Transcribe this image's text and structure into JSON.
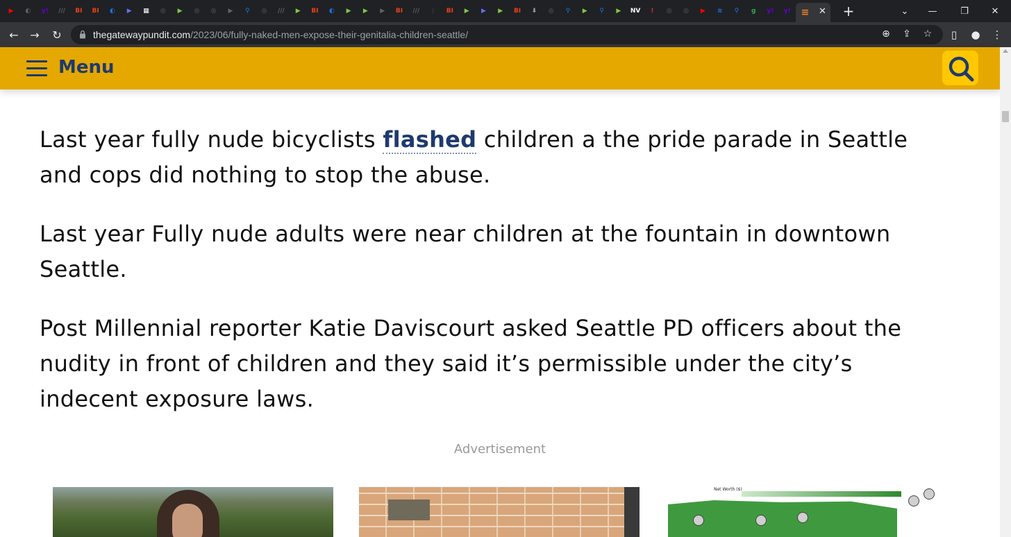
{
  "browser": {
    "tab_favicons": [
      {
        "icon": "youtube-icon",
        "color": "#ff0000",
        "glyph": "▶"
      },
      {
        "icon": "shield-icon",
        "color": "#5f6368",
        "glyph": "◐"
      },
      {
        "icon": "yahoo-icon",
        "color": "#6001d2",
        "glyph": "y!"
      },
      {
        "icon": "stripes-icon",
        "color": "#5f6368",
        "glyph": "///"
      },
      {
        "icon": "bi-icon",
        "color": "#e8401c",
        "glyph": "BI"
      },
      {
        "icon": "bi-icon",
        "color": "#e8401c",
        "glyph": "BI"
      },
      {
        "icon": "shield-icon",
        "color": "#1a73e8",
        "glyph": "◐"
      },
      {
        "icon": "flag-icon",
        "color": "#5f6fff",
        "glyph": "▶"
      },
      {
        "icon": "image-icon",
        "color": "#ffffff",
        "glyph": "▦"
      },
      {
        "icon": "globe-icon",
        "color": "#5f6368",
        "glyph": "◎"
      },
      {
        "icon": "rumble-icon",
        "color": "#85c742",
        "glyph": "▶"
      },
      {
        "icon": "globe-icon",
        "color": "#5f6368",
        "glyph": "◎"
      },
      {
        "icon": "globe-icon",
        "color": "#5f6368",
        "glyph": "◎"
      },
      {
        "icon": "flag-icon",
        "color": "#5f6368",
        "glyph": "▶"
      },
      {
        "icon": "search-icon",
        "color": "#1a73e8",
        "glyph": "⚲"
      },
      {
        "icon": "globe-icon",
        "color": "#5f6368",
        "glyph": "◎"
      },
      {
        "icon": "stripes-icon",
        "color": "#5f6368",
        "glyph": "///"
      },
      {
        "icon": "rumble-icon",
        "color": "#85c742",
        "glyph": "▶"
      },
      {
        "icon": "bi-icon",
        "color": "#e8401c",
        "glyph": "BI"
      },
      {
        "icon": "shield-icon",
        "color": "#1a73e8",
        "glyph": "◐"
      },
      {
        "icon": "rumble-icon",
        "color": "#85c742",
        "glyph": "▶"
      },
      {
        "icon": "rumble-icon",
        "color": "#85c742",
        "glyph": "▶"
      },
      {
        "icon": "flag-icon",
        "color": "#5f6368",
        "glyph": "▶"
      },
      {
        "icon": "bi-icon",
        "color": "#e8401c",
        "glyph": "BI"
      },
      {
        "icon": "stripes-icon",
        "color": "#5f6368",
        "glyph": "///"
      },
      {
        "icon": "dark-icon",
        "color": "#2b2b2b",
        "glyph": "▮"
      },
      {
        "icon": "bi-icon",
        "color": "#e8401c",
        "glyph": "BI"
      },
      {
        "icon": "rumble-icon",
        "color": "#85c742",
        "glyph": "▶"
      },
      {
        "icon": "flag-icon",
        "color": "#5f6fff",
        "glyph": "▶"
      },
      {
        "icon": "rumble-icon",
        "color": "#85c742",
        "glyph": "▶"
      },
      {
        "icon": "bi-icon",
        "color": "#e8401c",
        "glyph": "BI"
      },
      {
        "icon": "download-icon",
        "color": "#9aa0a6",
        "glyph": "⬇"
      },
      {
        "icon": "globe-icon",
        "color": "#5f6368",
        "glyph": "◎"
      },
      {
        "icon": "search-icon",
        "color": "#1a73e8",
        "glyph": "⚲"
      },
      {
        "icon": "rumble-icon",
        "color": "#85c742",
        "glyph": "▶"
      },
      {
        "icon": "search-icon",
        "color": "#1a73e8",
        "glyph": "⚲"
      },
      {
        "icon": "rumble-icon",
        "color": "#85c742",
        "glyph": "▶"
      },
      {
        "icon": "news-icon",
        "color": "#ffffff",
        "glyph": "NV"
      },
      {
        "icon": "alert-icon",
        "color": "#d93025",
        "glyph": "!"
      },
      {
        "icon": "globe-icon",
        "color": "#5f6368",
        "glyph": "◎"
      },
      {
        "icon": "globe-icon",
        "color": "#5f6368",
        "glyph": "◎"
      },
      {
        "icon": "youtube-icon",
        "color": "#ff0000",
        "glyph": "▶"
      },
      {
        "icon": "feed-icon",
        "color": "#1a73e8",
        "glyph": "≋"
      },
      {
        "icon": "search-icon",
        "color": "#1a73e8",
        "glyph": "⚲"
      },
      {
        "icon": "g-icon",
        "color": "#34a853",
        "glyph": "g"
      },
      {
        "icon": "yahoo-icon",
        "color": "#6001d2",
        "glyph": "y!"
      },
      {
        "icon": "yahoo-icon",
        "color": "#6001d2",
        "glyph": "y!"
      }
    ],
    "active_tab_favicon": {
      "icon": "stack-icon",
      "color": "#f48024",
      "glyph": "≡"
    },
    "close_glyph": "✕",
    "new_tab_glyph": "+",
    "window_controls": {
      "tab_search": "⌄",
      "minimize": "—",
      "restore": "❐",
      "close": "✕"
    },
    "nav": {
      "back": "←",
      "forward": "→",
      "reload": "↻"
    },
    "url_host": "thegatewaypundit.com",
    "url_path": "/2023/06/fully-naked-men-expose-their-genitalia-children-seattle/",
    "omnibox_icons": {
      "zoom": "⊕",
      "share": "⇪",
      "bookmark": "☆"
    },
    "toolbar_icons": {
      "sidepanel": "▯",
      "profile": "●",
      "menu": "⋮"
    }
  },
  "site": {
    "menu_label": "Menu",
    "accent_color": "#e5a800",
    "brand_text_color": "#1e3a6e"
  },
  "article": {
    "p1_before": "Last year fully nude bicyclists ",
    "p1_link": "flashed",
    "p1_after": " children a the pride parade in Seattle and cops did nothing to stop the abuse.",
    "p2": "Last year Fully nude adults were near children at the fountain in downtown Seattle.",
    "p3": "Post Millennial reporter Katie Daviscourt asked Seattle PD officers about the nudity in front of children and they said it’s permissible under the city’s indecent exposure laws."
  },
  "ads": {
    "label": "Advertisement",
    "map_title": "Net Worth ($)"
  }
}
